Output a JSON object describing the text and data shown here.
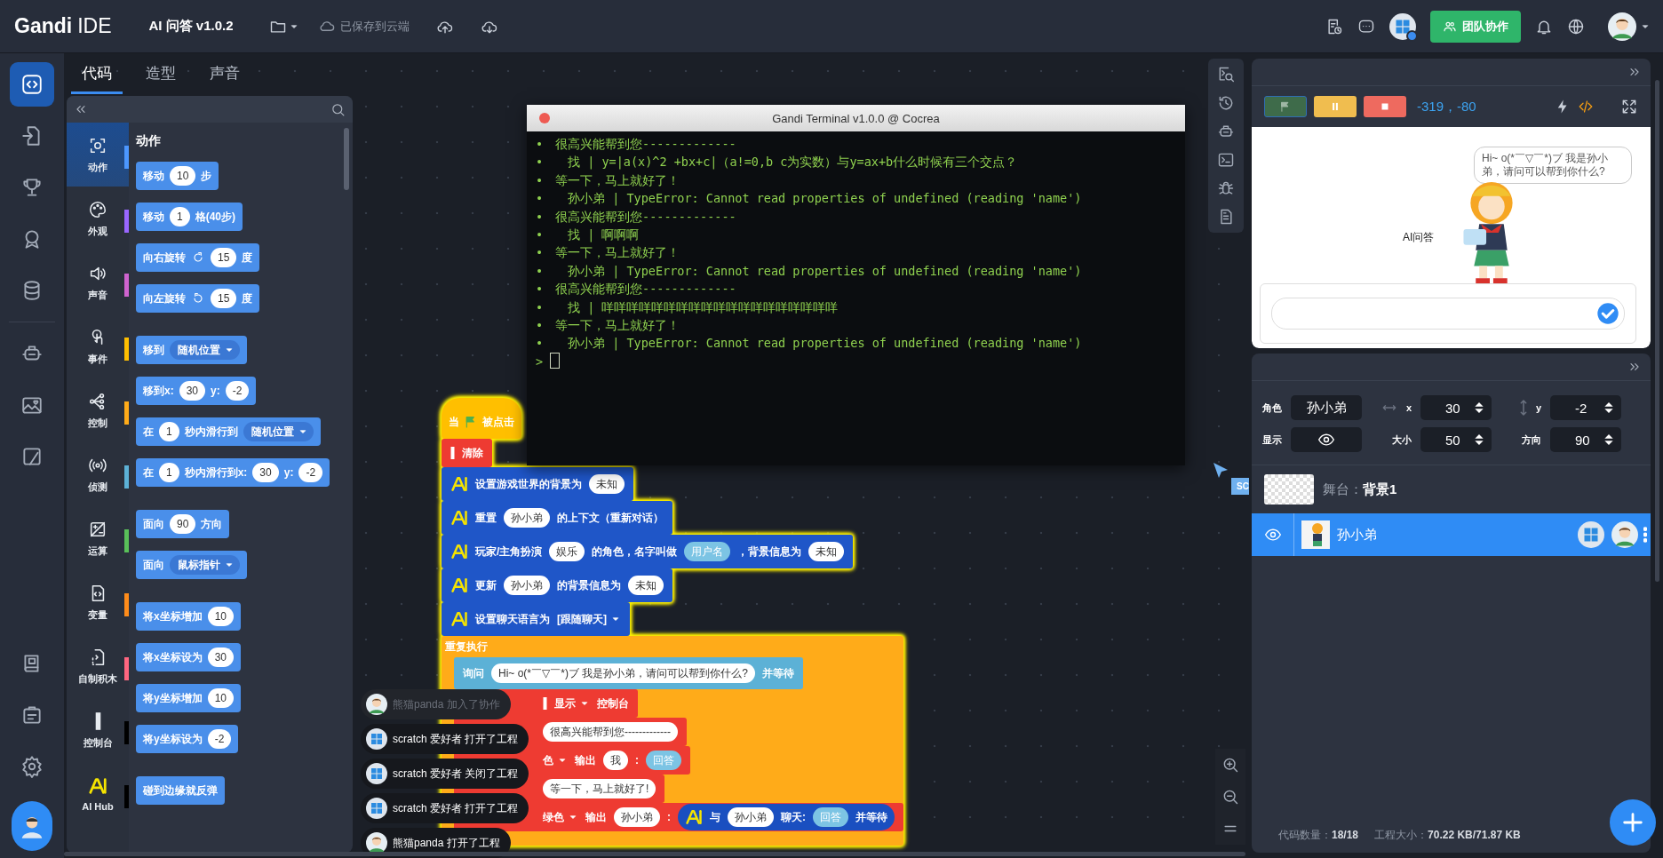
{
  "top_bar": {
    "brand": "Gandi",
    "brand_suffix": "IDE",
    "project_title": "AI 问答 v1.0.2",
    "save_status": "已保存到云端",
    "collab_button": "团队协作",
    "presence_online": true
  },
  "nav_rail": {
    "items": [
      {
        "kind": "code",
        "selected": true
      },
      {
        "kind": "import",
        "selected": false
      },
      {
        "kind": "trophy",
        "selected": false
      },
      {
        "kind": "badge",
        "selected": false
      },
      {
        "kind": "database",
        "selected": false
      },
      {
        "kind": "robot",
        "selected": false
      },
      {
        "kind": "image",
        "selected": false
      },
      {
        "kind": "cards",
        "selected": false
      }
    ],
    "bottom_items": [
      {
        "kind": "book",
        "selected": false
      },
      {
        "kind": "briefcase",
        "selected": false
      },
      {
        "kind": "settings",
        "selected": false
      }
    ]
  },
  "editor_tabs": [
    {
      "label": "代码",
      "selected": true
    },
    {
      "label": "造型",
      "selected": false
    },
    {
      "label": "声音",
      "selected": false
    }
  ],
  "palette": {
    "categories": [
      {
        "label": "动作",
        "kind": "motion",
        "color": "#4c97ff",
        "selected": true
      },
      {
        "label": "外观",
        "kind": "looks",
        "color": "#9966ff",
        "selected": false
      },
      {
        "label": "声音",
        "kind": "sound",
        "color": "#cf63cf",
        "selected": false
      },
      {
        "label": "事件",
        "kind": "events",
        "color": "#ffbf00",
        "selected": false
      },
      {
        "label": "控制",
        "kind": "control",
        "color": "#ffab19",
        "selected": false
      },
      {
        "label": "侦测",
        "kind": "sensing",
        "color": "#5cb1d6",
        "selected": false
      },
      {
        "label": "运算",
        "kind": "operators",
        "color": "#59c059",
        "selected": false
      },
      {
        "label": "变量",
        "kind": "variables",
        "color": "#ff8c1a",
        "selected": false
      },
      {
        "label": "自制积木",
        "kind": "myblocks",
        "color": "#ff6680",
        "selected": false
      },
      {
        "label": "控制台",
        "kind": "console",
        "color": "#000000",
        "selected": false
      },
      {
        "label": "AI Hub",
        "kind": "ai",
        "color": "#000000",
        "selected": false
      }
    ],
    "section_title": "动作",
    "block_groups": [
      [
        {
          "parts": [
            {
              "kind": "text",
              "text": "移动"
            },
            {
              "kind": "input",
              "text": "10"
            },
            {
              "kind": "text",
              "text": "步"
            }
          ]
        },
        {
          "parts": [
            {
              "kind": "text",
              "text": "移动"
            },
            {
              "kind": "input",
              "text": "1"
            },
            {
              "kind": "text",
              "text": "格(40步)"
            }
          ]
        },
        {
          "parts": [
            {
              "kind": "text",
              "text": "向右旋转"
            },
            {
              "kind": "rotate_cw"
            },
            {
              "kind": "input",
              "text": "15"
            },
            {
              "kind": "text",
              "text": "度"
            }
          ]
        },
        {
          "parts": [
            {
              "kind": "text",
              "text": "向左旋转"
            },
            {
              "kind": "rotate_ccw"
            },
            {
              "kind": "input",
              "text": "15"
            },
            {
              "kind": "text",
              "text": "度"
            }
          ]
        }
      ],
      [
        {
          "parts": [
            {
              "kind": "text",
              "text": "移到"
            },
            {
              "kind": "dropdown",
              "text": "随机位置"
            }
          ]
        },
        {
          "parts": [
            {
              "kind": "text",
              "text": "移到x:"
            },
            {
              "kind": "input",
              "text": "30"
            },
            {
              "kind": "text",
              "text": "y:"
            },
            {
              "kind": "input",
              "text": "-2"
            }
          ]
        },
        {
          "parts": [
            {
              "kind": "text",
              "text": "在"
            },
            {
              "kind": "input",
              "text": "1"
            },
            {
              "kind": "text",
              "text": "秒内滑行到"
            },
            {
              "kind": "dropdown",
              "text": "随机位置"
            }
          ]
        },
        {
          "parts": [
            {
              "kind": "text",
              "text": "在"
            },
            {
              "kind": "input",
              "text": "1"
            },
            {
              "kind": "text",
              "text": "秒内滑行到x:"
            },
            {
              "kind": "input",
              "text": "30"
            },
            {
              "kind": "text",
              "text": "y:"
            },
            {
              "kind": "input",
              "text": "-2"
            }
          ]
        }
      ],
      [
        {
          "parts": [
            {
              "kind": "text",
              "text": "面向"
            },
            {
              "kind": "input",
              "text": "90"
            },
            {
              "kind": "text",
              "text": "方向"
            }
          ]
        },
        {
          "parts": [
            {
              "kind": "text",
              "text": "面向"
            },
            {
              "kind": "dropdown",
              "text": "鼠标指针"
            }
          ]
        }
      ],
      [
        {
          "parts": [
            {
              "kind": "text",
              "text": "将x坐标增加"
            },
            {
              "kind": "input",
              "text": "10"
            }
          ]
        },
        {
          "parts": [
            {
              "kind": "text",
              "text": "将x坐标设为"
            },
            {
              "kind": "input",
              "text": "30"
            }
          ]
        },
        {
          "parts": [
            {
              "kind": "text",
              "text": "将y坐标增加"
            },
            {
              "kind": "input",
              "text": "10"
            }
          ]
        },
        {
          "parts": [
            {
              "kind": "text",
              "text": "将y坐标设为"
            },
            {
              "kind": "input",
              "text": "-2"
            }
          ]
        }
      ],
      [
        {
          "parts": [
            {
              "kind": "text",
              "text": "碰到边缘就反弹"
            }
          ]
        }
      ]
    ]
  },
  "canvas": {
    "script": [
      {
        "kind": "hat",
        "parts": [
          {
            "kind": "text",
            "text": "当"
          },
          {
            "kind": "flag"
          },
          {
            "kind": "text",
            "text": "被点击"
          }
        ]
      },
      {
        "kind": "console",
        "parts": [
          {
            "kind": "console"
          },
          {
            "kind": "text",
            "text": "清除"
          }
        ]
      },
      {
        "kind": "ai",
        "parts": [
          {
            "kind": "ai"
          },
          {
            "kind": "text",
            "text": "设置游戏世界的背景为"
          },
          {
            "kind": "input",
            "text": "未知"
          }
        ]
      },
      {
        "kind": "ai",
        "parts": [
          {
            "kind": "ai"
          },
          {
            "kind": "text",
            "text": "重置"
          },
          {
            "kind": "input",
            "text": "孙小弟"
          },
          {
            "kind": "text",
            "text": "的上下文（重新对话）"
          }
        ]
      },
      {
        "kind": "ai",
        "parts": [
          {
            "kind": "ai"
          },
          {
            "kind": "text",
            "text": "玩家/主角扮演"
          },
          {
            "kind": "input",
            "text": "娱乐"
          },
          {
            "kind": "text",
            "text": "的角色，名字叫做"
          },
          {
            "kind": "reporter",
            "text": "用户名"
          },
          {
            "kind": "text",
            "text": "，背景信息为"
          },
          {
            "kind": "input",
            "text": "未知"
          }
        ]
      },
      {
        "kind": "ai",
        "parts": [
          {
            "kind": "ai"
          },
          {
            "kind": "text",
            "text": "更新"
          },
          {
            "kind": "input",
            "text": "孙小弟"
          },
          {
            "kind": "text",
            "text": "的背景信息为"
          },
          {
            "kind": "input",
            "text": "未知"
          }
        ]
      },
      {
        "kind": "ai",
        "parts": [
          {
            "kind": "ai"
          },
          {
            "kind": "text",
            "text": "设置聊天语言为"
          },
          {
            "kind": "menu",
            "text": "[跟随聊天]"
          }
        ]
      },
      {
        "kind": "repeat",
        "label": "重复执行",
        "children": [
          {
            "kind": "ask",
            "lead_hidden": false,
            "parts": [
              {
                "kind": "text",
                "text": "询问"
              },
              {
                "kind": "input",
                "text": "Hi~ o(*￣▽￣*)ブ 我是孙小弟，请问可以帮到你什么?"
              },
              {
                "kind": "text",
                "text": "并等待"
              }
            ]
          },
          {
            "kind": "console",
            "lead_hidden": true,
            "parts": [
              {
                "kind": "console"
              },
              {
                "kind": "menu",
                "text": "显示"
              },
              {
                "kind": "text",
                "text": "控制台"
              }
            ]
          },
          {
            "kind": "console",
            "lead_hidden": true,
            "parts": [
              {
                "kind": "input",
                "text": "很高兴能帮到您-------------"
              }
            ]
          },
          {
            "kind": "console",
            "lead_hidden": true,
            "parts": [
              {
                "kind": "menu",
                "text": "色"
              },
              {
                "kind": "text",
                "text": "输出"
              },
              {
                "kind": "input",
                "text": "我"
              },
              {
                "kind": "text",
                "text": ":"
              },
              {
                "kind": "reporter",
                "text": "回答"
              }
            ]
          },
          {
            "kind": "console",
            "lead_hidden": true,
            "parts": [
              {
                "kind": "input",
                "text": "等一下，马上就好了!"
              }
            ]
          },
          {
            "kind": "console",
            "lead_hidden": true,
            "parts": [
              {
                "kind": "menu",
                "text": "绿色"
              },
              {
                "kind": "text",
                "text": "输出"
              },
              {
                "kind": "input",
                "text": "孙小弟"
              },
              {
                "kind": "text",
                "text": ":"
              },
              {
                "kind": "block",
                "parts": [
                  {
                    "kind": "ai"
                  },
                  {
                    "kind": "text",
                    "text": "与"
                  },
                  {
                    "kind": "input",
                    "text": "孙小弟"
                  },
                  {
                    "kind": "text",
                    "text": "聊天:"
                  },
                  {
                    "kind": "reporter",
                    "text": "回答"
                  },
                  {
                    "kind": "text",
                    "text": "并等待"
                  }
                ]
              }
            ]
          }
        ]
      }
    ],
    "notifications": [
      {
        "text": "熊猫panda 加入了协作",
        "kind": "boy",
        "faded": true
      },
      {
        "text": "scratch 爱好者 打开了工程",
        "kind": "windows",
        "faded": false
      },
      {
        "text": "scratch 爱好者 关闭了工程",
        "kind": "windows",
        "faded": false
      },
      {
        "text": "scratch 爱好者 打开了工程",
        "kind": "windows",
        "faded": false
      },
      {
        "text": "熊猫panda 打开了工程",
        "kind": "boy",
        "faded": false
      }
    ],
    "cursor_label": "SC"
  },
  "terminal": {
    "title": "Gandi Terminal v1.0.0 @ Cocrea",
    "lines": [
      {
        "marker": "•",
        "indented": false,
        "text": "很高兴能帮到您-------------"
      },
      {
        "marker": "•",
        "indented": true,
        "text": "找 | y=|a(x)^2 +bx+c|（a!=0,b c为实数）与y=ax+b什么时候有三个交点？"
      },
      {
        "marker": "•",
        "indented": false,
        "text": "等一下，马上就好了！"
      },
      {
        "marker": "•",
        "indented": true,
        "text": "孙小弟 | TypeError: Cannot read properties of undefined (reading 'name')"
      },
      {
        "marker": "•",
        "indented": false,
        "text": "很高兴能帮到您-------------"
      },
      {
        "marker": "•",
        "indented": true,
        "text": "找 | 啊啊啊"
      },
      {
        "marker": "•",
        "indented": false,
        "text": "等一下，马上就好了！"
      },
      {
        "marker": "•",
        "indented": true,
        "text": "孙小弟 | TypeError: Cannot read properties of undefined (reading 'name')"
      },
      {
        "marker": "•",
        "indented": false,
        "text": "很高兴能帮到您-------------"
      },
      {
        "marker": "•",
        "indented": true,
        "text": "找 | 咩咩咩咩咩咩咩咩咩咩咩咩咩咩咩咩咩咩咩"
      },
      {
        "marker": "•",
        "indented": false,
        "text": "等一下，马上就好了！"
      },
      {
        "marker": "•",
        "indented": true,
        "text": "孙小弟 | TypeError: Cannot read properties of undefined (reading 'name')"
      }
    ],
    "prompt": ">"
  },
  "stage": {
    "coordinates": "-319，-80",
    "speech": "Hi~ o(*￣▽￣*)ブ 我是孙小弟，请问可以帮到你什么?",
    "label": "AI问答"
  },
  "sprite_info": {
    "fields": [
      {
        "kind": "text",
        "label": "角色",
        "value": "孙小弟"
      },
      {
        "kind": "axis_x",
        "label": "x",
        "value": "30"
      },
      {
        "kind": "axis_y",
        "label": "y",
        "value": "-2"
      },
      {
        "kind": "toggle",
        "label": "显示",
        "on": true
      },
      {
        "kind": "number",
        "label": "大小",
        "value": "50"
      },
      {
        "kind": "number",
        "label": "方向",
        "value": "90"
      }
    ]
  },
  "stage_row": {
    "label": "舞台：",
    "backdrop": "背景1"
  },
  "sprites": [
    {
      "name": "孙小弟",
      "selected": true,
      "visible": true,
      "editors": [
        {
          "kind": "windows"
        },
        {
          "kind": "boy"
        }
      ]
    }
  ],
  "footer": {
    "code_count_label": "代码数量：",
    "code_count": "18/18",
    "size_label": "工程大小：",
    "size": "70.22 KB/71.87 KB"
  }
}
